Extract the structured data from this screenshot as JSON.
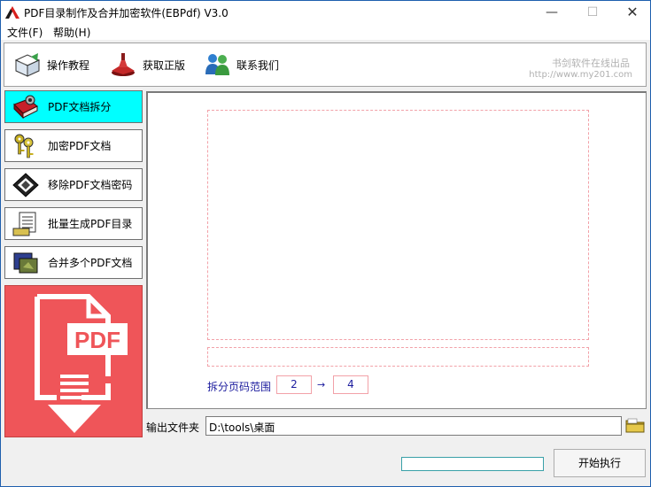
{
  "window": {
    "title": "PDF目录制作及合并加密软件(EBPdf) V3.0",
    "minimize_glyph": "—",
    "maximize_glyph": "☐",
    "close_glyph": "✕"
  },
  "menu": {
    "items": [
      {
        "label": "文件(F)"
      },
      {
        "label": "帮助(H)"
      }
    ]
  },
  "toolbar": {
    "buttons": [
      {
        "label": "操作教程",
        "icon": "tutorial-icon"
      },
      {
        "label": "获取正版",
        "icon": "get-license-icon"
      },
      {
        "label": "联系我们",
        "icon": "contact-icon"
      }
    ],
    "brand_name": "书剑软件在线出品",
    "brand_url": "http://www.my201.com"
  },
  "sidebar": {
    "items": [
      {
        "label": "PDF文档拆分",
        "icon": "split-icon",
        "active": true
      },
      {
        "label": "加密PDF文档",
        "icon": "keys-icon",
        "active": false
      },
      {
        "label": "移除PDF文档密码",
        "icon": "remove-password-icon",
        "active": false
      },
      {
        "label": "批量生成PDF目录",
        "icon": "toc-icon",
        "active": false
      },
      {
        "label": "合并多个PDF文档",
        "icon": "merge-icon",
        "active": false
      }
    ],
    "logo": {
      "text": "PDF",
      "color": "#ef5559"
    }
  },
  "split": {
    "range_label": "拆分页码范围",
    "from_page": "2",
    "arrow": "→",
    "to_page": "4"
  },
  "output": {
    "label": "输出文件夹",
    "path": "D:\\tools\\桌面"
  },
  "progress": {
    "value": 0.0
  },
  "actions": {
    "start_label": "开始执行"
  },
  "colors": {
    "active_tab": "#00ffff",
    "logo_bg": "#ef5559",
    "range_text": "#1c1c9e",
    "dashed_border": "#f2a1a8"
  }
}
